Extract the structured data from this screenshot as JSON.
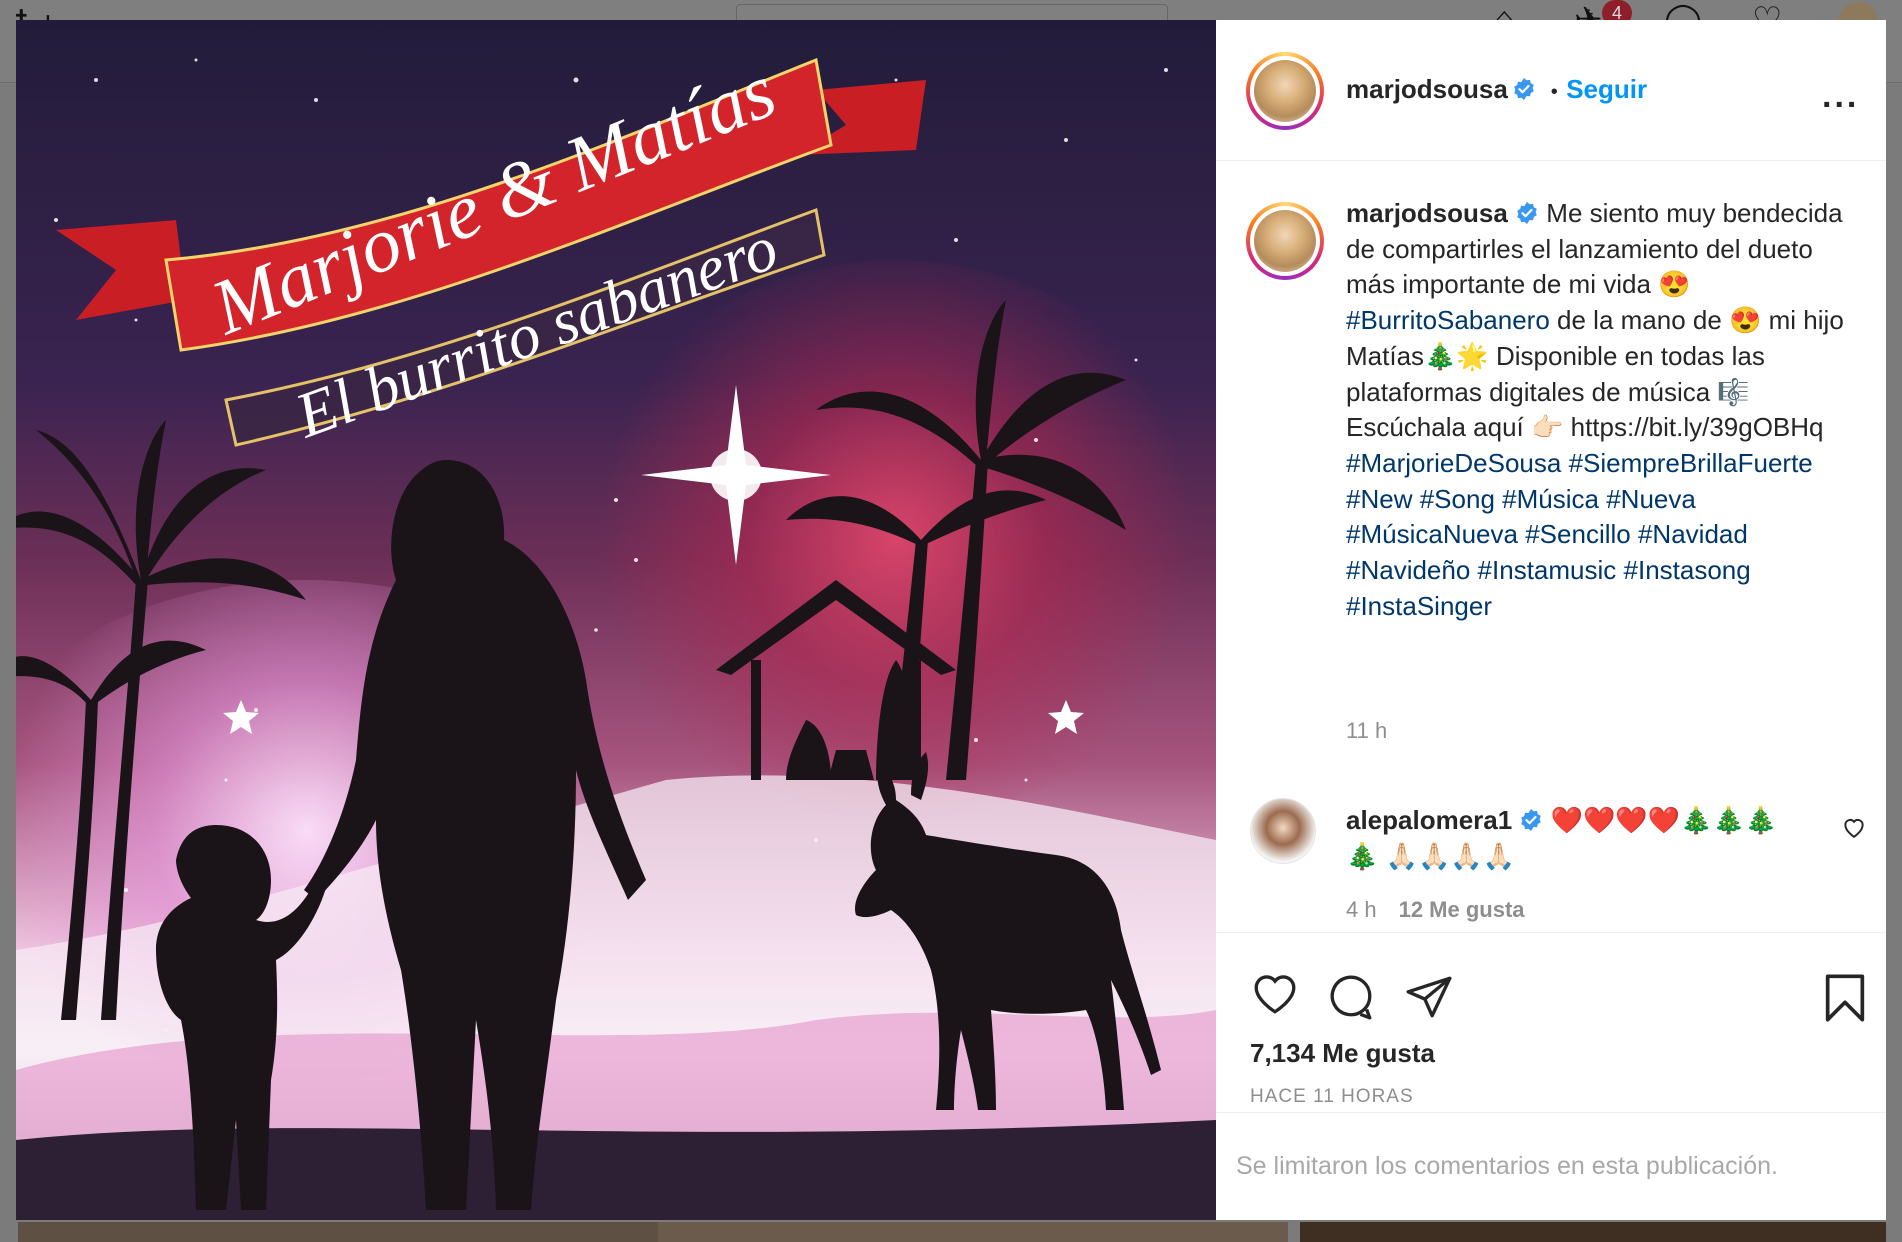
{
  "post": {
    "username": "marjodsousa",
    "follow_label": "Seguir",
    "separator": "•",
    "more_label": "...",
    "image_title": "Marjorie & Matías",
    "image_subtitle": "El burrito sabanero",
    "caption": {
      "username": "marjodsousa",
      "text_1": " Me siento muy bendecida de compartirles el lanzamiento del dueto más importante de mi vida 😍 ",
      "hashtag_1": "#BurritoSabanero",
      "text_2": " de la mano de 😍 mi hijo Matías🎄🌟 Disponible en todas las plataformas digitales de música 🎼 Escúchala aquí 👉🏻 https://bit.ly/39gOBHq ",
      "hashtags": [
        "#MarjorieDeSousa",
        "#SiempreBrillaFuerte",
        "#New",
        "#Song",
        "#Música",
        "#Nueva",
        "#MúsicaNueva",
        "#Sencillo",
        "#Navidad",
        "#Navideño",
        "#Instamusic",
        "#Instasong",
        "#InstaSinger"
      ],
      "time": "11 h"
    },
    "comment": {
      "username": "alepalomera1",
      "text": " ❤️❤️❤️❤️🎄🎄🎄🎄 🙏🏻🙏🏻🙏🏻🙏🏻",
      "time": "4 h",
      "likes": "12 Me gusta"
    },
    "likes_count": "7,134 Me gusta",
    "posted_ago": "HACE 11 HORAS",
    "comments_limited": "Se limitaron los comentarios en esta publicación."
  },
  "background_nav": {
    "notification_count": "4"
  },
  "icons": [
    "verified-badge-icon",
    "more-options-icon",
    "like-heart-icon",
    "comment-icon",
    "share-icon",
    "save-bookmark-icon",
    "comment-like-icon",
    "home-icon",
    "messenger-icon",
    "explore-icon",
    "activity-heart-icon"
  ],
  "colors": {
    "link_blue": "#0095f6",
    "hashtag": "#00376b",
    "text": "#262626",
    "muted": "#8e8e8e",
    "verified": "#3897f0"
  }
}
